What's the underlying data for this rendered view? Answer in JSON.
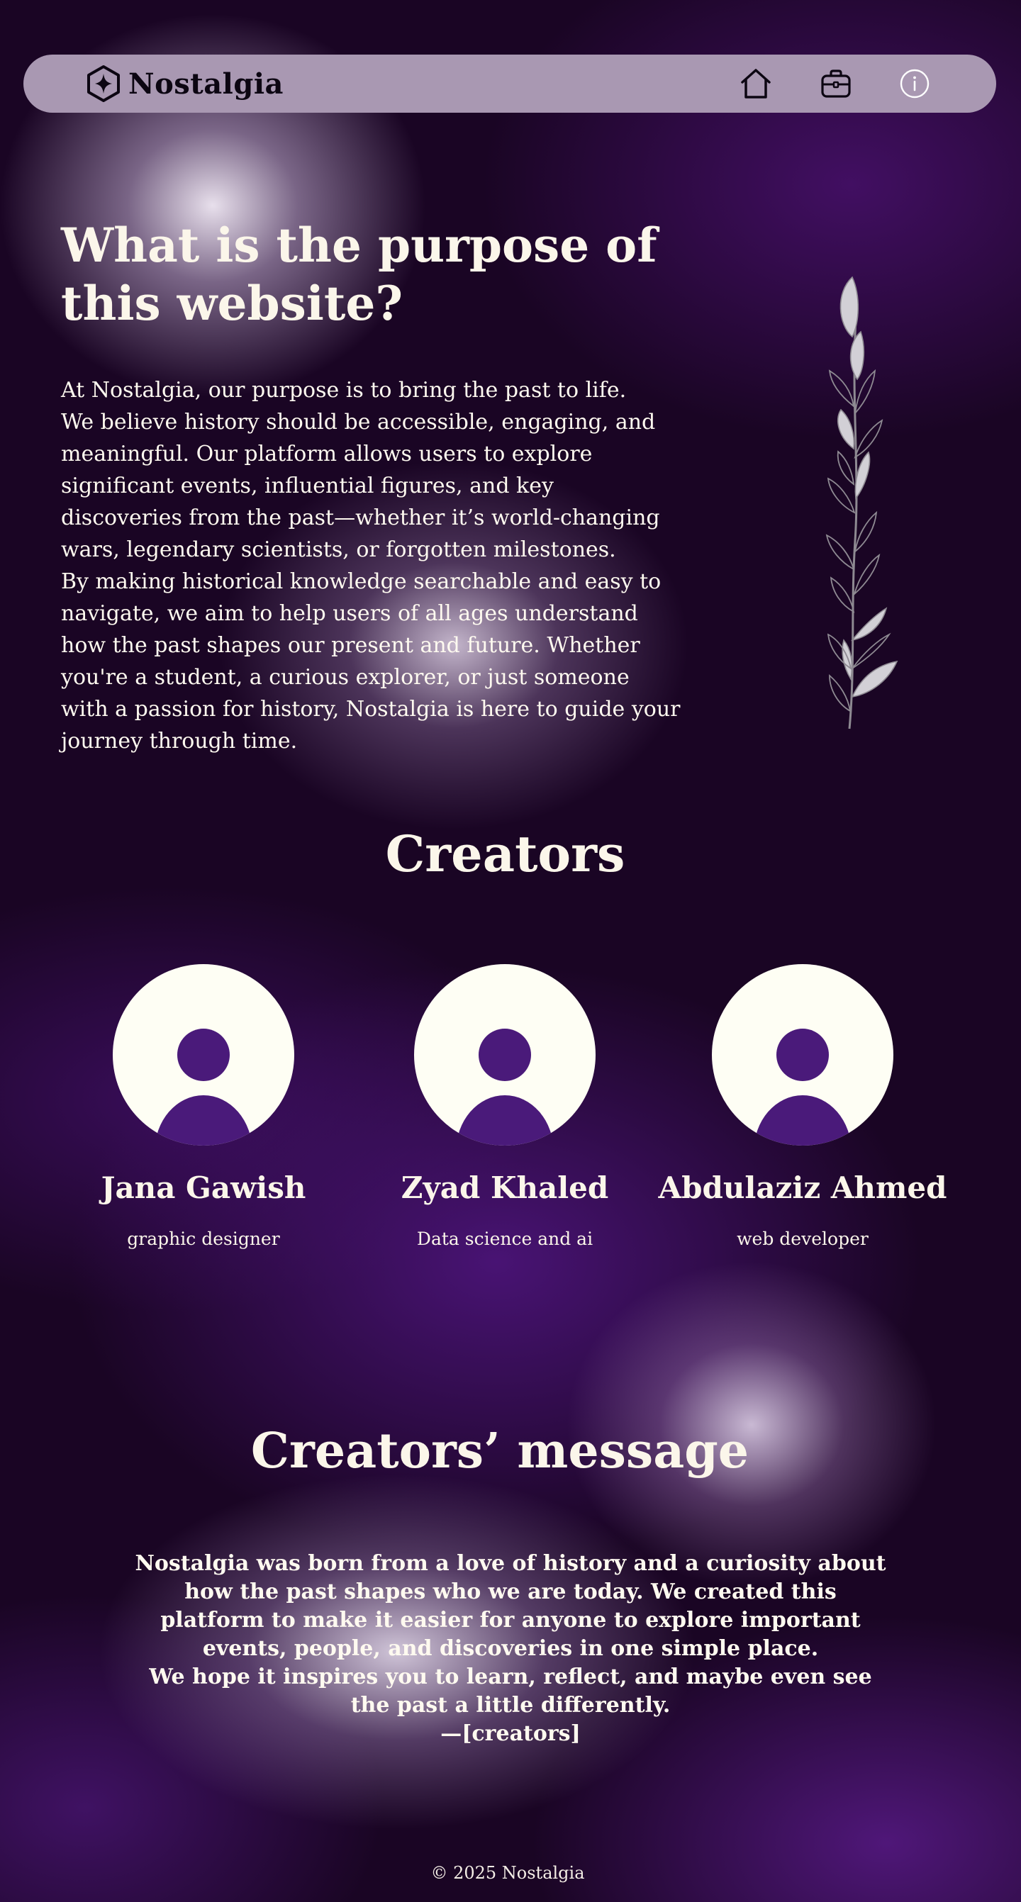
{
  "header": {
    "brand": "Nostalgia",
    "logo_icon": "hexagon-star-logo",
    "nav_icons": [
      "home-icon",
      "briefcase-icon",
      "info-icon"
    ]
  },
  "purpose": {
    "title_lines": [
      "What is the purpose of",
      "this website?"
    ],
    "paragraph_lines": [
      "At Nostalgia, our purpose is to bring the past to life.",
      "We believe history should be accessible, engaging, and",
      "meaningful. Our platform allows users to explore",
      "significant events, influential figures, and key",
      "discoveries from the past—whether it’s world-changing",
      "wars, legendary scientists, or forgotten milestones.",
      "By making historical knowledge searchable and easy to",
      "navigate, we aim to help users of all ages understand",
      "how the past shapes our present and future. Whether",
      "you're a student, a curious explorer, or just someone",
      "with a passion for history, Nostalgia is here to guide your",
      "journey through time."
    ]
  },
  "creators": {
    "title": "Creators",
    "people": [
      {
        "name": "Jana Gawish",
        "role": "graphic designer"
      },
      {
        "name": "Zyad Khaled",
        "role": "Data science and ai"
      },
      {
        "name": "Abdulaziz Ahmed",
        "role": "web developer"
      }
    ]
  },
  "message": {
    "title": "Creators’ message",
    "lines": [
      "Nostalgia was born from a love of history and a curiosity about",
      "how the past shapes who we are today. We created this",
      "platform to make it easier for anyone to explore important",
      "events, people, and discoveries in one simple place.",
      "We hope it inspires you to learn, reflect, and maybe even see",
      "the past a little differently.",
      "—[creators]"
    ]
  },
  "footer": {
    "text": "© 2025 Nostalgia"
  },
  "colors": {
    "nav_background": "#a998b2",
    "avatar_background": "#fefef4",
    "avatar_figure": "#4a1a7a",
    "text_light": "#fbf6ea"
  }
}
